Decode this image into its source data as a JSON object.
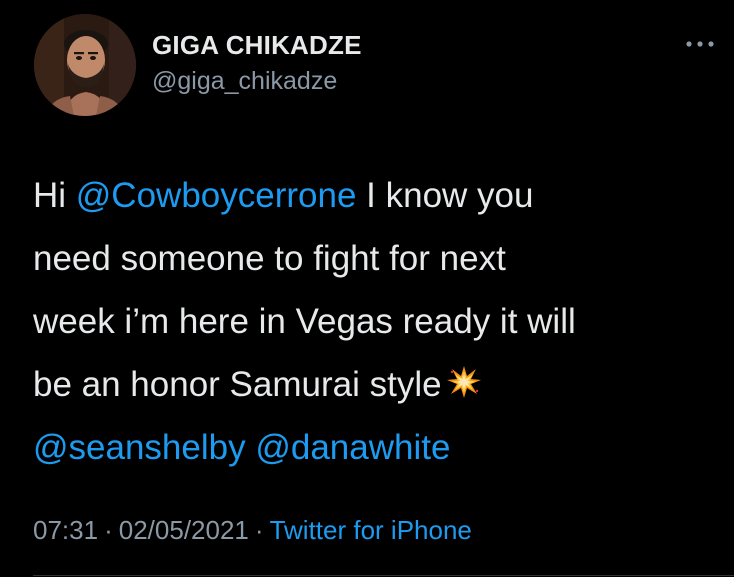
{
  "colors": {
    "background": "#000000",
    "text": "#e7e9ea",
    "secondary_text": "#8b98a5",
    "link": "#1d9bf0",
    "divider": "#2f3336"
  },
  "author": {
    "display_name": "GIGA CHIKADZE",
    "handle": "@giga_chikadze",
    "avatar_icon": "avatar-photo"
  },
  "more_icon": "more-options-icon",
  "tweet": {
    "lines": [
      {
        "pre": "Hi ",
        "mention": "@Cowboycerrone",
        "post": " I know you"
      },
      {
        "text": "need someone to fight  for next"
      },
      {
        "text": "week i’m here in Vegas ready it will"
      },
      {
        "text": "be an honor Samurai style",
        "emoji": "collision-emoji"
      },
      {
        "mention1": "@seanshelby",
        "space": " ",
        "mention2": "@danawhite"
      }
    ]
  },
  "meta": {
    "time": "07:31",
    "separator": "·",
    "date": "02/05/2021",
    "source": "Twitter for iPhone"
  }
}
